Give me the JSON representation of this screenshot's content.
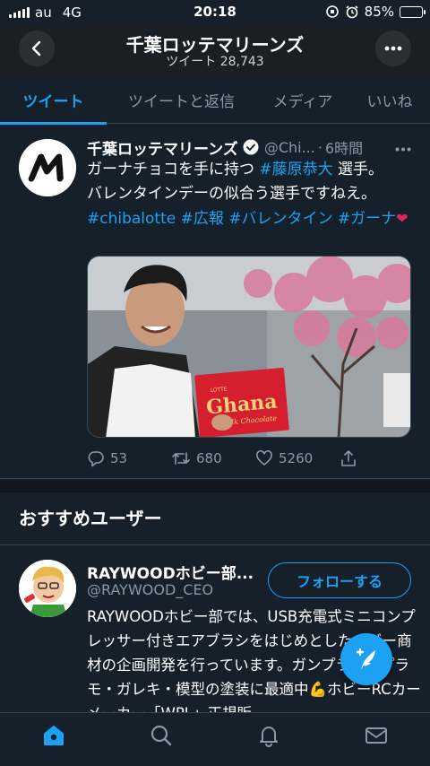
{
  "status_bar": {
    "carrier": "au",
    "network": "4G",
    "time": "20:18",
    "battery": "85%",
    "battery_level": 0.85
  },
  "header": {
    "title": "千葉ロッテマリーンズ",
    "subtitle": "ツイート 28,743"
  },
  "tabs": [
    {
      "label": "ツイート",
      "active": true
    },
    {
      "label": "ツイートと返信",
      "active": false
    },
    {
      "label": "メディア",
      "active": false
    },
    {
      "label": "いいね",
      "active": false
    }
  ],
  "tweet": {
    "name": "千葉ロッテマリーンズ",
    "handle": "@Chi...",
    "dot": "·",
    "time": "6時間",
    "text1": "ガーナチョコを手に持つ ",
    "tag1": "#藤原恭大",
    "text2": " 選手。",
    "text3": "バレンタインデーの似合う選手ですねえ。",
    "tags": "#chibalotte #広報 #バレンタイン #ガーナ",
    "emoji": "❤",
    "replies": "53",
    "retweets": "680",
    "likes": "5260",
    "media_chocolate_brand": "Ghana",
    "media_chocolate_maker": "LOTTE",
    "media_chocolate_sub": "Milk Chocolate"
  },
  "recommended": {
    "title": "おすすめユーザー",
    "user": {
      "name": "RAYWOODホビー部...",
      "handle": "@RAYWOOD_CEO",
      "follow_label": "フォローする",
      "bio": "RAYWOODホビー部では、USB充電式ミニコンプレッサー付きエアブラシをはじめとしたホビー商材の企画開発を行っています。ガンプラ等のプラモ・ガレキ・模型の塗装に最適中💪ホビーRCカーメーカー「WPL」正規販"
    }
  },
  "colors": {
    "background": "#15202b",
    "accent": "#1da1f2",
    "muted": "#8899a6",
    "border": "#38444d"
  },
  "icons": {
    "back": "chevron-left-icon",
    "more": "more-horizontal-icon",
    "verified": "verified-badge-icon",
    "reply": "reply-icon",
    "retweet": "retweet-icon",
    "like": "heart-icon",
    "share": "share-icon",
    "compose": "compose-tweet-icon",
    "home": "home-icon",
    "search": "search-icon",
    "notifications": "bell-icon",
    "messages": "mail-icon"
  }
}
